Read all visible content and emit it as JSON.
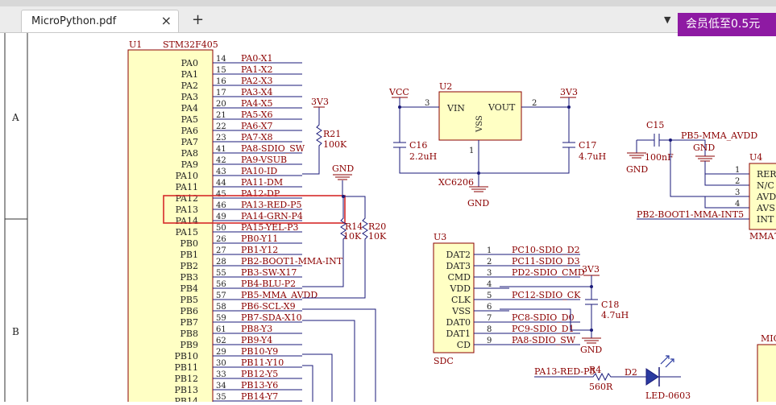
{
  "tab": {
    "title": "MicroPython.pdf",
    "close": "×"
  },
  "toolbar": {
    "new_tab": "+",
    "dropdown": "▼",
    "promo": "会员低至0.5元"
  },
  "border": {
    "zone_a": "A",
    "zone_b": "B"
  },
  "u1": {
    "ref": "U1",
    "part": "STM32F405",
    "pins": [
      {
        "name": "PA0",
        "num": "14",
        "net": "PA0-X1"
      },
      {
        "name": "PA1",
        "num": "15",
        "net": "PA1-X2"
      },
      {
        "name": "PA2",
        "num": "16",
        "net": "PA2-X3"
      },
      {
        "name": "PA3",
        "num": "17",
        "net": "PA3-X4"
      },
      {
        "name": "PA4",
        "num": "20",
        "net": "PA4-X5"
      },
      {
        "name": "PA5",
        "num": "21",
        "net": "PA5-X6"
      },
      {
        "name": "PA6",
        "num": "22",
        "net": "PA6-X7"
      },
      {
        "name": "PA7",
        "num": "23",
        "net": "PA7-X8"
      },
      {
        "name": "PA8",
        "num": "41",
        "net": "PA8-SDIO_SW"
      },
      {
        "name": "PA9",
        "num": "42",
        "net": "PA9-VSUB"
      },
      {
        "name": "PA10",
        "num": "43",
        "net": "PA10-ID"
      },
      {
        "name": "PA11",
        "num": "44",
        "net": "PA11-DM"
      },
      {
        "name": "PA12",
        "num": "45",
        "net": "PA12-DP"
      },
      {
        "name": "PA13",
        "num": "46",
        "net": "PA13-RED-P5"
      },
      {
        "name": "PA14",
        "num": "49",
        "net": "PA14-GRN-P4"
      },
      {
        "name": "PA15",
        "num": "50",
        "net": "PA15-YEL-P3"
      },
      {
        "name": "PB0",
        "num": "26",
        "net": "PB0-Y11"
      },
      {
        "name": "PB1",
        "num": "27",
        "net": "PB1-Y12"
      },
      {
        "name": "PB2",
        "num": "28",
        "net": "PB2-BOOT1-MMA-INT"
      },
      {
        "name": "PB3",
        "num": "55",
        "net": "PB3-SW-X17"
      },
      {
        "name": "PB4",
        "num": "56",
        "net": "PB4-BLU-P2"
      },
      {
        "name": "PB5",
        "num": "57",
        "net": "PB5-MMA_AVDD"
      },
      {
        "name": "PB6",
        "num": "58",
        "net": "PB6-SCL-X9"
      },
      {
        "name": "PB7",
        "num": "59",
        "net": "PB7-SDA-X10"
      },
      {
        "name": "PB8",
        "num": "61",
        "net": "PB8-Y3"
      },
      {
        "name": "PB9",
        "num": "62",
        "net": "PB9-Y4"
      },
      {
        "name": "PB10",
        "num": "29",
        "net": "PB10-Y9"
      },
      {
        "name": "PB11",
        "num": "30",
        "net": "PB11-Y10"
      },
      {
        "name": "PB12",
        "num": "33",
        "net": "PB12-Y5"
      },
      {
        "name": "PB13",
        "num": "34",
        "net": "PB13-Y6"
      },
      {
        "name": "PB14",
        "num": "35",
        "net": "PB14-Y7"
      }
    ]
  },
  "r21": {
    "ref": "R21",
    "value": "100K",
    "rail": "3V3"
  },
  "r14": {
    "ref": "R14",
    "value": "10K"
  },
  "r20": {
    "ref": "R20",
    "value": "10K"
  },
  "gnd_label": "GND",
  "u2": {
    "ref": "U2",
    "part": "XC6206",
    "vin": "VIN",
    "vout": "VOUT",
    "vss": "VSS",
    "pin_in": "3",
    "pin_out": "2",
    "pin_gnd": "1",
    "vcc": "VCC",
    "v3": "3V3"
  },
  "c16": {
    "ref": "C16",
    "value": "2.2uH"
  },
  "c17": {
    "ref": "C17",
    "value": "4.7uH"
  },
  "u3": {
    "ref": "U3",
    "part": "SDC",
    "pins": [
      {
        "name": "DAT2",
        "num": "1",
        "net": "PC10-SDIO_D2"
      },
      {
        "name": "DAT3",
        "num": "2",
        "net": "PC11-SDIO_D3"
      },
      {
        "name": "CMD",
        "num": "3",
        "net": "PD2-SDIO_CMD"
      },
      {
        "name": "VDD",
        "num": "4",
        "net": ""
      },
      {
        "name": "CLK",
        "num": "5",
        "net": "PC12-SDIO_CK"
      },
      {
        "name": "VSS",
        "num": "6",
        "net": ""
      },
      {
        "name": "DAT0",
        "num": "7",
        "net": "PC8-SDIO_D0"
      },
      {
        "name": "DAT1",
        "num": "8",
        "net": "PC9-SDIO_D1"
      },
      {
        "name": "CD",
        "num": "9",
        "net": "PA8-SDIO_SW"
      }
    ],
    "v3": "3V3"
  },
  "c18": {
    "ref": "C18",
    "value": "4.7uH"
  },
  "c15": {
    "ref": "C15",
    "value": "100nF"
  },
  "u4": {
    "ref": "U4",
    "part": "MMA7",
    "pins": [
      {
        "name": "RER",
        "num": "1"
      },
      {
        "name": "N/C",
        "num": "2"
      },
      {
        "name": "AVD",
        "num": "3"
      },
      {
        "name": "AVS",
        "num": "4"
      },
      {
        "name": "INT",
        "num": ""
      }
    ],
    "net_avdd": "PB5-MMA_AVDD",
    "net_int": "PB2-BOOT1-MMA-INT5"
  },
  "r4": {
    "ref": "R4",
    "value": "560R",
    "net": "PA13-RED-P5"
  },
  "d2": {
    "ref": "D2",
    "value": "LED-0603"
  },
  "mic": {
    "label": "MIC"
  },
  "colors": {
    "wire": "#1a1a7a",
    "label": "#8b0000",
    "component_fill": "#ffffc4",
    "highlight": "#d62a2a",
    "promo": "#8e1aa3"
  }
}
